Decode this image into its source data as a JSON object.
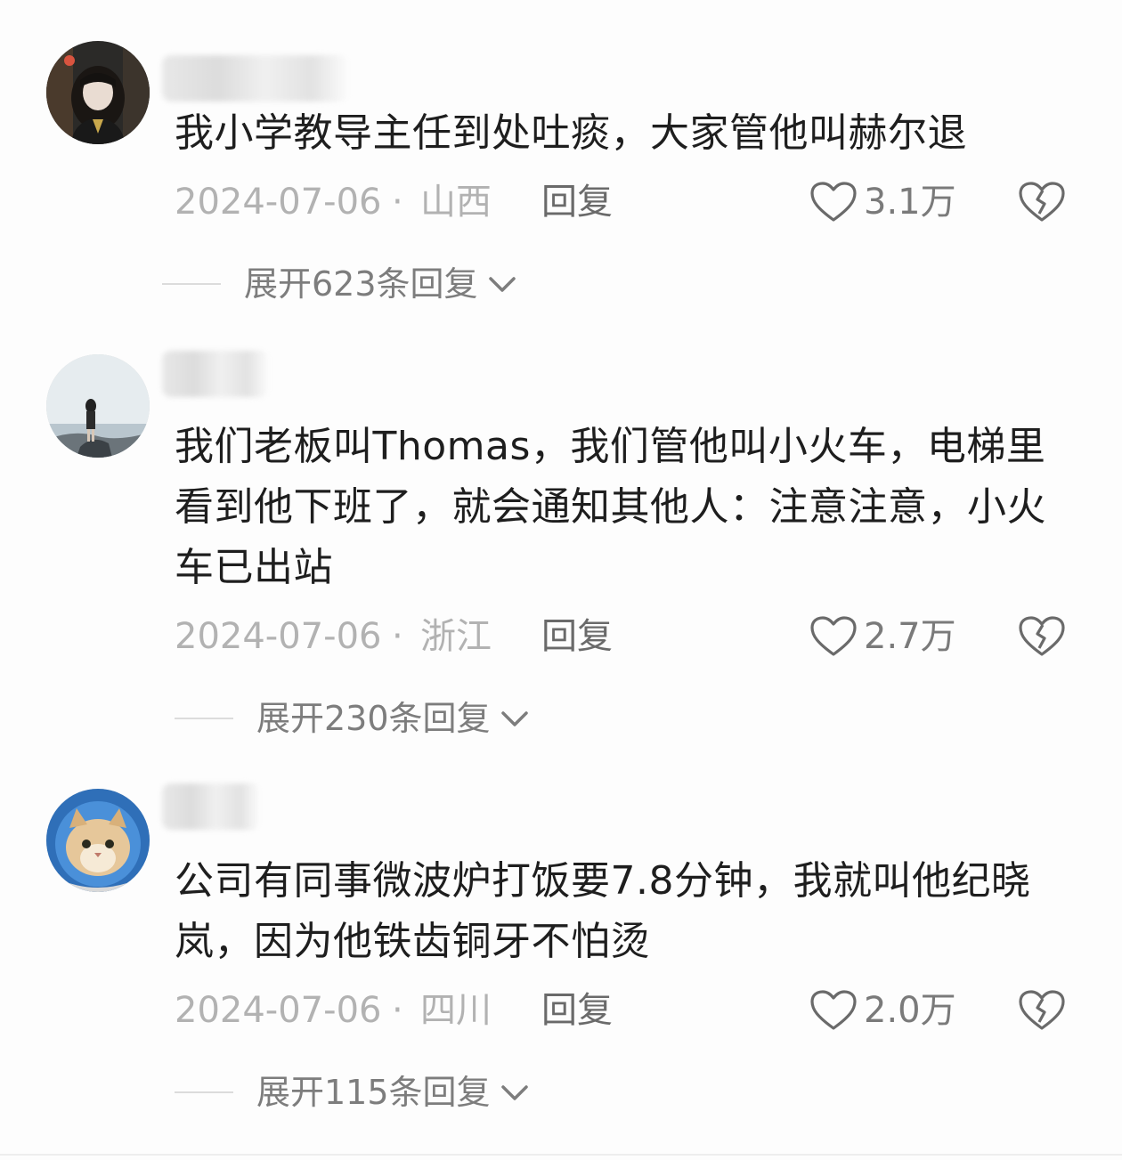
{
  "comments": [
    {
      "text": "我小学教导主任到处吐痰，大家管他叫赫尔退",
      "date": "2024-07-06",
      "separator": "·",
      "location": "山西",
      "reply_label": "回复",
      "likes": "3.1万",
      "expand_label": "展开623条回复"
    },
    {
      "text": "我们老板叫Thomas，我们管他叫小火车，电梯里看到他下班了，就会通知其他人：注意注意，小火车已出站",
      "date": "2024-07-06",
      "separator": "·",
      "location": "浙江",
      "reply_label": "回复",
      "likes": "2.7万",
      "expand_label": "展开230条回复"
    },
    {
      "text": "公司有同事微波炉打饭要7.8分钟，我就叫他纪晓岚，因为他铁齿铜牙不怕烫",
      "date": "2024-07-06",
      "separator": "·",
      "location": "四川",
      "reply_label": "回复",
      "likes": "2.0万",
      "expand_label": "展开115条回复"
    }
  ],
  "icons": {
    "like": "heart-outline-icon",
    "dislike": "broken-heart-icon",
    "expand": "chevron-down-icon"
  },
  "colors": {
    "text": "#1e1e1e",
    "meta": "#b2b2b2",
    "action": "#6a6a6a"
  }
}
